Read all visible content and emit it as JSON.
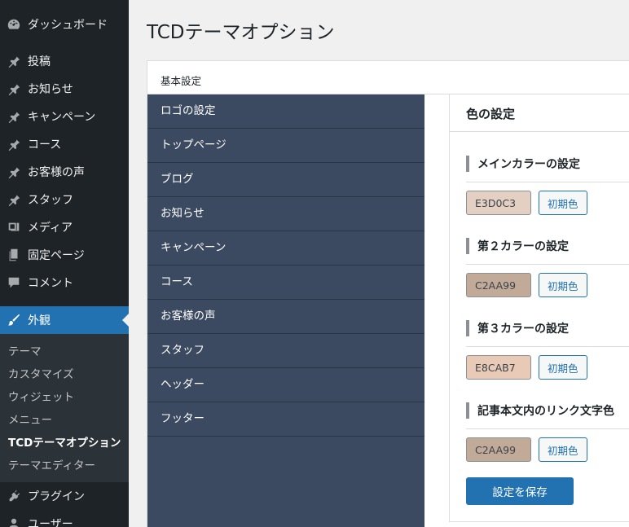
{
  "sidebar": {
    "items": [
      {
        "label": "ダッシュボード",
        "icon": "dashboard-icon"
      },
      {
        "label": "投稿",
        "icon": "pin-icon"
      },
      {
        "label": "お知らせ",
        "icon": "pin-icon"
      },
      {
        "label": "キャンペーン",
        "icon": "pin-icon"
      },
      {
        "label": "コース",
        "icon": "pin-icon"
      },
      {
        "label": "お客様の声",
        "icon": "pin-icon"
      },
      {
        "label": "スタッフ",
        "icon": "pin-icon"
      },
      {
        "label": "メディア",
        "icon": "media-icon"
      },
      {
        "label": "固定ページ",
        "icon": "page-icon"
      },
      {
        "label": "コメント",
        "icon": "comment-icon"
      },
      {
        "label": "外観",
        "icon": "brush-icon"
      },
      {
        "label": "プラグイン",
        "icon": "plugin-icon"
      },
      {
        "label": "ユーザー",
        "icon": "user-icon"
      }
    ],
    "submenu": [
      {
        "label": "テーマ"
      },
      {
        "label": "カスタマイズ"
      },
      {
        "label": "ウィジェット"
      },
      {
        "label": "メニュー"
      },
      {
        "label": "TCDテーマオプション"
      },
      {
        "label": "テーマエディター"
      }
    ]
  },
  "page": {
    "title": "TCDテーマオプション",
    "tab_label": "基本設定"
  },
  "optnav": {
    "items": [
      {
        "label": "ロゴの設定"
      },
      {
        "label": "トップページ"
      },
      {
        "label": "ブログ"
      },
      {
        "label": "お知らせ"
      },
      {
        "label": "キャンペーン"
      },
      {
        "label": "コース"
      },
      {
        "label": "お客様の声"
      },
      {
        "label": "スタッフ"
      },
      {
        "label": "ヘッダー"
      },
      {
        "label": "フッター"
      }
    ]
  },
  "color_settings": {
    "title": "色の設定",
    "sections": [
      {
        "label": "メインカラーの設定",
        "value": "E3D0C3",
        "color": "#E3D0C3"
      },
      {
        "label": "第２カラーの設定",
        "value": "C2AA99",
        "color": "#C2AA99"
      },
      {
        "label": "第３カラーの設定",
        "value": "E8CAB7",
        "color": "#E8CAB7"
      },
      {
        "label": "記事本文内のリンク文字色",
        "value": "C2AA99",
        "color": "#C2AA99"
      }
    ],
    "default_label": "初期色",
    "save_label": "設定を保存"
  },
  "colors": {
    "sidebar_bg": "#1d2327",
    "active_bg": "#2271b1",
    "optnav_bg": "#3c4a61"
  }
}
